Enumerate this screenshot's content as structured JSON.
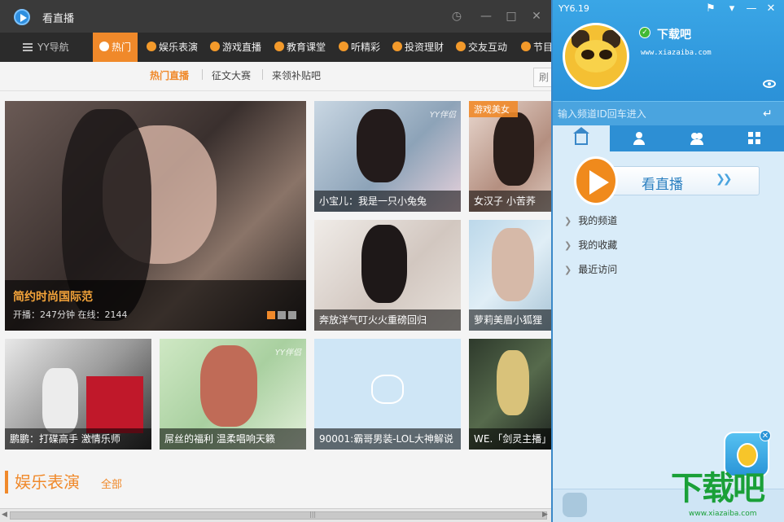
{
  "live": {
    "title": "看直播",
    "nav": [
      {
        "label": "YY导航",
        "icon": "menu-icon"
      },
      {
        "label": "热门",
        "icon": "fire-icon"
      },
      {
        "label": "娱乐表演",
        "icon": "smile-icon"
      },
      {
        "label": "游戏直播",
        "icon": "gamepad-icon"
      },
      {
        "label": "教育课堂",
        "icon": "star-icon"
      },
      {
        "label": "听精彩",
        "icon": "music-icon"
      },
      {
        "label": "投资理财",
        "icon": "chart-icon"
      },
      {
        "label": "交友互动",
        "icon": "link-icon"
      },
      {
        "label": "节目",
        "icon": "star-icon"
      }
    ],
    "active_nav": "热门",
    "subnav": [
      "热门直播",
      "征文大赛",
      "来领补贴吧"
    ],
    "refresh_label": "刷",
    "featured": {
      "title": "简约时尚国际范",
      "meta": "开播：247分钟   在线：2144"
    },
    "tiles": [
      {
        "caption": "小宝儿：我是一只小兔兔",
        "watermark": "YY伴侣"
      },
      {
        "caption": "女汉子 小苦荞",
        "tag": "游戏美女"
      },
      {
        "caption": "奔放洋气叮火火重磅回归"
      },
      {
        "caption": "萝莉美眉小狐狸"
      },
      {
        "caption": "鹏鹏：打碟高手 激情乐师"
      },
      {
        "caption": "屌丝的福利 温柔唱响天籁",
        "watermark": "YY伴侣"
      },
      {
        "caption": "90001:霸哥男装-LOL大神解说"
      },
      {
        "caption": "WE.「剑灵主播」"
      }
    ],
    "section": {
      "title": "娱乐表演",
      "all_label": "全部"
    }
  },
  "yy": {
    "version": "YY6.19",
    "username": "下载吧",
    "site_line": "www.xiazaiba.com",
    "search_placeholder": "输入频道ID回车进入",
    "live_button": "看直播",
    "links": [
      "我的频道",
      "我的收藏",
      "最近访问"
    ]
  },
  "watermark": {
    "brand": "下载吧",
    "site": "www.xiazaiba.com"
  },
  "colors": {
    "accent": "#f0892a",
    "yy_blue": "#2b91d8",
    "nav_dark": "#2b2b2b",
    "watermark_green": "#1aa038"
  }
}
